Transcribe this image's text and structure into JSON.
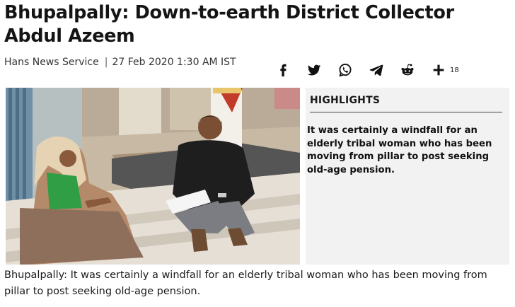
{
  "article": {
    "headline": "Bhupalpally: Down-to-earth District Collector Abdul Azeem",
    "byline": {
      "source": "Hans News Service",
      "separator": "|",
      "datetime": "27 Feb 2020 1:30 AM IST"
    },
    "share": {
      "icons": [
        "facebook-icon",
        "twitter-icon",
        "whatsapp-icon",
        "telegram-icon",
        "reddit-icon",
        "plus-icon"
      ],
      "count": "18"
    },
    "highlights": {
      "title": "HIGHLIGHTS",
      "text": "It was certainly a windfall for an elderly tribal woman who has been moving from pillar to post seeking old-age pension."
    },
    "caption": "Bhupalpally: It was certainly a windfall for an elderly tribal woman who has been moving from pillar to post seeking old-age pension."
  },
  "colors": {
    "headline": "#141414",
    "highlights_bg": "#f2f2f2",
    "icon": "#111111"
  }
}
